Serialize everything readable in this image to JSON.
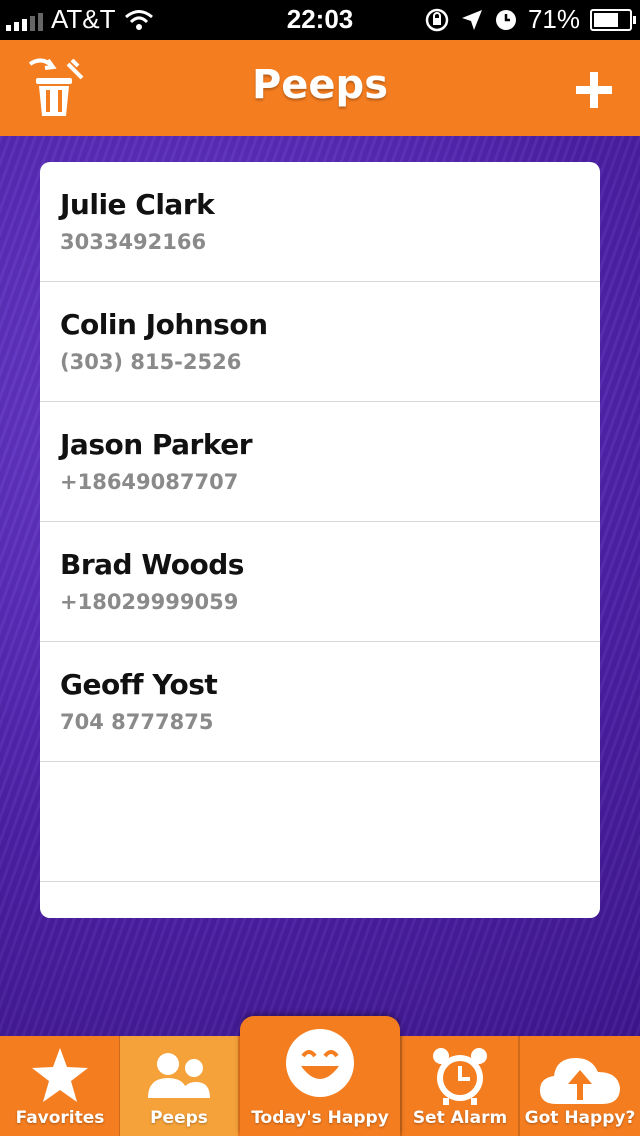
{
  "status_bar": {
    "carrier": "AT&T",
    "time": "22:03",
    "battery": "71%",
    "battery_level": 0.71,
    "icons": [
      "signal-icon",
      "wifi-icon",
      "orientation-lock-icon",
      "location-icon",
      "alarm-icon",
      "battery-icon"
    ]
  },
  "nav": {
    "title": "Peeps",
    "left_icon": "trash-icon",
    "right_icon": "plus-icon"
  },
  "contacts": [
    {
      "name": "Julie Clark",
      "phone": "3033492166"
    },
    {
      "name": "Colin Johnson",
      "phone": "(303) 815-2526"
    },
    {
      "name": "Jason Parker",
      "phone": "+18649087707"
    },
    {
      "name": "Brad Woods",
      "phone": "+18029999059"
    },
    {
      "name": "Geoff Yost",
      "phone": "704 8777875"
    }
  ],
  "tabs": [
    {
      "label": "Favorites",
      "icon": "star-icon"
    },
    {
      "label": "Peeps",
      "icon": "people-icon",
      "selected": true
    },
    {
      "label": "Today's Happy",
      "icon": "smiley-icon"
    },
    {
      "label": "Set Alarm",
      "icon": "alarm-clock-icon"
    },
    {
      "label": "Got Happy?",
      "icon": "cloud-upload-icon"
    }
  ],
  "colors": {
    "accent": "#f47d20",
    "selected_tab": "#f5a23a",
    "background": "#5a2fb6",
    "phone_text": "#8a8a8a"
  }
}
